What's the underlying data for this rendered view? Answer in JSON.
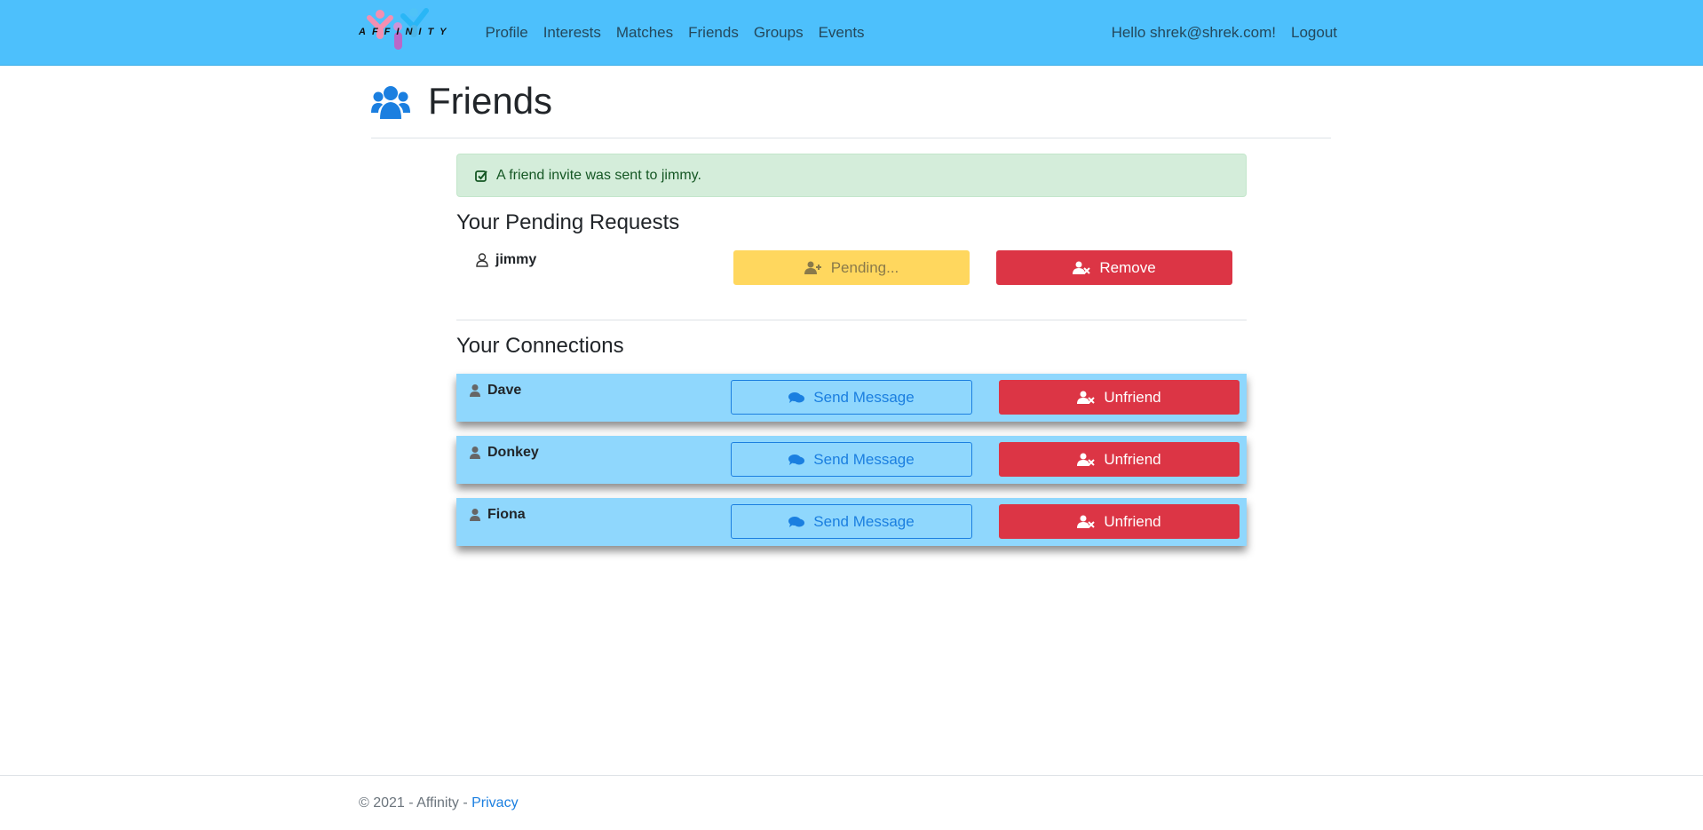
{
  "nav": {
    "brand": "AFFINITY",
    "links": [
      "Profile",
      "Interests",
      "Matches",
      "Friends",
      "Groups",
      "Events"
    ],
    "greeting": "Hello shrek@shrek.com!",
    "logout": "Logout"
  },
  "page": {
    "title": "Friends",
    "title_icon": "users-icon"
  },
  "alert": {
    "text": "A friend invite was sent to jimmy.",
    "icon": "check-square-icon"
  },
  "pending": {
    "heading": "Your Pending Requests",
    "items": [
      {
        "name": "jimmy",
        "status_label": "Pending...",
        "action_label": "Remove"
      }
    ]
  },
  "connections": {
    "heading": "Your Connections",
    "items": [
      {
        "name": "Dave",
        "message_label": "Send Message",
        "unfriend_label": "Unfriend"
      },
      {
        "name": "Donkey",
        "message_label": "Send Message",
        "unfriend_label": "Unfriend"
      },
      {
        "name": "Fiona",
        "message_label": "Send Message",
        "unfriend_label": "Unfriend"
      }
    ]
  },
  "footer": {
    "copyright": "© 2021 - Affinity - ",
    "privacy": "Privacy"
  },
  "colors": {
    "navbar": "#4dc0fc",
    "card": "#8fd7fd",
    "danger": "#dc3545",
    "warning": "#ffd75e",
    "primary": "#1b7fe0",
    "success_bg": "#d4edda"
  }
}
